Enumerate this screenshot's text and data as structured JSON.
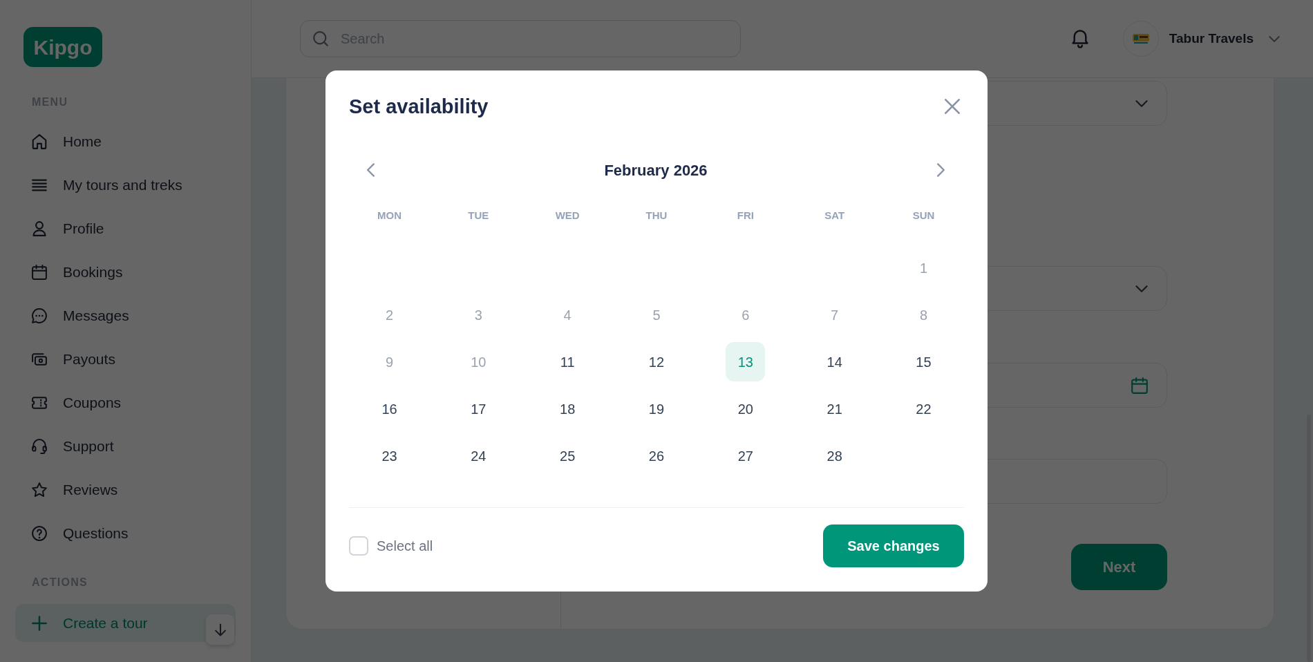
{
  "sidebar": {
    "logo": "Kipgo",
    "menu_heading": "MENU",
    "menu_items": [
      {
        "label": "Home",
        "selected": false
      },
      {
        "label": "My tours and treks",
        "selected": false
      },
      {
        "label": "Profile",
        "selected": false
      },
      {
        "label": "Bookings",
        "selected": false
      },
      {
        "label": "Messages",
        "selected": false
      },
      {
        "label": "Payouts",
        "selected": false
      },
      {
        "label": "Coupons",
        "selected": false
      },
      {
        "label": "Support",
        "selected": false
      },
      {
        "label": "Reviews",
        "selected": false
      },
      {
        "label": "Questions",
        "selected": false
      }
    ],
    "actions_heading": "ACTIONS",
    "actions": [
      {
        "label": "Create a tour",
        "selected": true
      }
    ]
  },
  "topbar": {
    "search": {
      "placeholder": "Search"
    },
    "account": {
      "name": "Tabur Travels"
    }
  },
  "form": {
    "fields": [
      {
        "kind": "select"
      },
      {
        "kind": "select"
      },
      {
        "kind": "date"
      },
      {
        "kind": "text"
      }
    ],
    "next_button": "Next"
  },
  "modal": {
    "title": "Set availability",
    "month": "February 2026",
    "weekdays": [
      "MON",
      "TUE",
      "WED",
      "THU",
      "FRI",
      "SAT",
      "SUN"
    ],
    "weeks": [
      {
        "kind": "first",
        "days": [
          {
            "day": "1",
            "disabled": true,
            "selected": false
          }
        ]
      },
      {
        "kind": "full",
        "days": [
          {
            "day": "2",
            "disabled": true,
            "selected": false
          },
          {
            "day": "3",
            "disabled": true,
            "selected": false
          },
          {
            "day": "4",
            "disabled": true,
            "selected": false
          },
          {
            "day": "5",
            "disabled": true,
            "selected": false
          },
          {
            "day": "6",
            "disabled": true,
            "selected": false
          },
          {
            "day": "7",
            "disabled": true,
            "selected": false
          },
          {
            "day": "8",
            "disabled": true,
            "selected": false
          }
        ]
      },
      {
        "kind": "full",
        "days": [
          {
            "day": "9",
            "disabled": true,
            "selected": false
          },
          {
            "day": "10",
            "disabled": true,
            "selected": false
          },
          {
            "day": "11",
            "disabled": false,
            "selected": false
          },
          {
            "day": "12",
            "disabled": false,
            "selected": false
          },
          {
            "day": "13",
            "disabled": false,
            "selected": true
          },
          {
            "day": "14",
            "disabled": false,
            "selected": false
          },
          {
            "day": "15",
            "disabled": false,
            "selected": false
          }
        ]
      },
      {
        "kind": "full",
        "days": [
          {
            "day": "16",
            "disabled": false,
            "selected": false
          },
          {
            "day": "17",
            "disabled": false,
            "selected": false
          },
          {
            "day": "18",
            "disabled": false,
            "selected": false
          },
          {
            "day": "19",
            "disabled": false,
            "selected": false
          },
          {
            "day": "20",
            "disabled": false,
            "selected": false
          },
          {
            "day": "21",
            "disabled": false,
            "selected": false
          },
          {
            "day": "22",
            "disabled": false,
            "selected": false
          }
        ]
      },
      {
        "kind": "last",
        "days": [
          {
            "day": "23",
            "disabled": false,
            "selected": false
          },
          {
            "day": "24",
            "disabled": false,
            "selected": false
          },
          {
            "day": "25",
            "disabled": false,
            "selected": false
          },
          {
            "day": "26",
            "disabled": false,
            "selected": false
          },
          {
            "day": "27",
            "disabled": false,
            "selected": false
          },
          {
            "day": "28",
            "disabled": false,
            "selected": false
          }
        ]
      }
    ],
    "select_all": {
      "label": "Select all",
      "checked": false
    },
    "save_button": "Save changes"
  }
}
